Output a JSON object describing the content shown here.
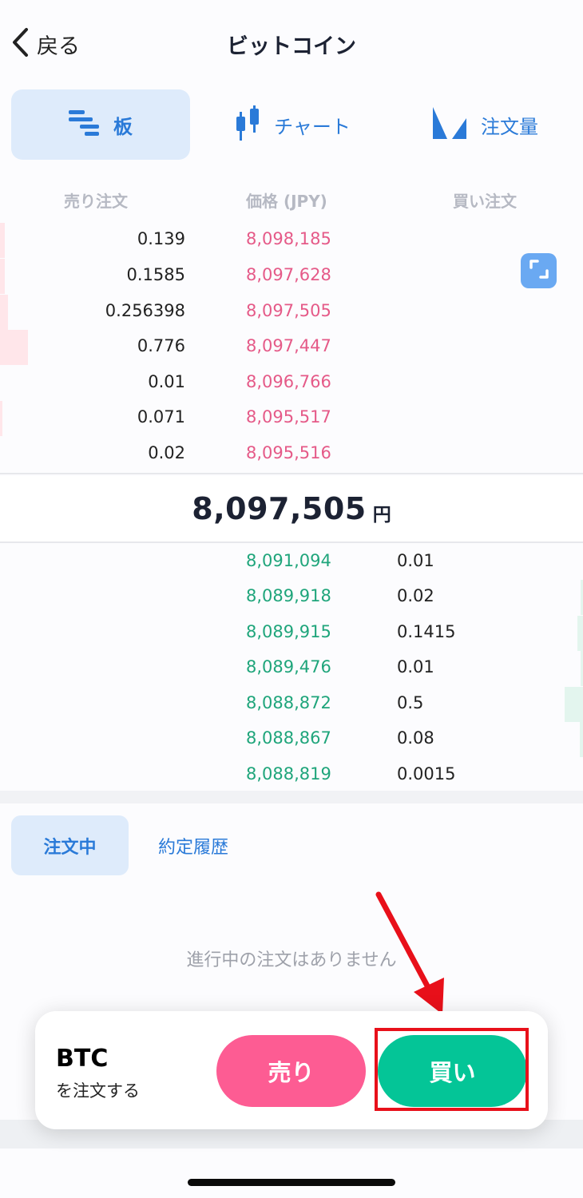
{
  "header": {
    "back_label": "戻る",
    "title": "ビットコイン"
  },
  "view_tabs": [
    {
      "label": "板",
      "icon": "order-book-icon",
      "active": true
    },
    {
      "label": "チャート",
      "icon": "candlestick-icon",
      "active": false
    },
    {
      "label": "注文量",
      "icon": "depth-chart-icon",
      "active": false
    }
  ],
  "order_book": {
    "columns": {
      "sell": "売り注文",
      "price": "価格 (JPY)",
      "buy": "買い注文"
    },
    "asks": [
      {
        "qty": "0.139",
        "price": "8,098,185"
      },
      {
        "qty": "0.1585",
        "price": "8,097,628"
      },
      {
        "qty": "0.256398",
        "price": "8,097,505"
      },
      {
        "qty": "0.776",
        "price": "8,097,447"
      },
      {
        "qty": "0.01",
        "price": "8,096,766"
      },
      {
        "qty": "0.071",
        "price": "8,095,517"
      },
      {
        "qty": "0.02",
        "price": "8,095,516"
      }
    ],
    "mid": {
      "price": "8,097,505",
      "unit": "円"
    },
    "bids": [
      {
        "price": "8,091,094",
        "qty": "0.01"
      },
      {
        "price": "8,089,918",
        "qty": "0.02"
      },
      {
        "price": "8,089,915",
        "qty": "0.1415"
      },
      {
        "price": "8,089,476",
        "qty": "0.01"
      },
      {
        "price": "8,088,872",
        "qty": "0.5"
      },
      {
        "price": "8,088,867",
        "qty": "0.08"
      },
      {
        "price": "8,088,819",
        "qty": "0.0015"
      }
    ]
  },
  "order_tabs": {
    "open": "注文中",
    "history": "約定履歴"
  },
  "empty_message": "進行中の注文はありません",
  "action_panel": {
    "asset": "BTC",
    "subtitle": "を注文する",
    "sell_label": "売り",
    "buy_label": "買い"
  },
  "colors": {
    "accent": "#2a7ad8",
    "sell": "#fd5c93",
    "buy": "#04c597",
    "ask_price": "#e55a88",
    "bid_price": "#1fa57b",
    "highlight": "#e8101a"
  }
}
